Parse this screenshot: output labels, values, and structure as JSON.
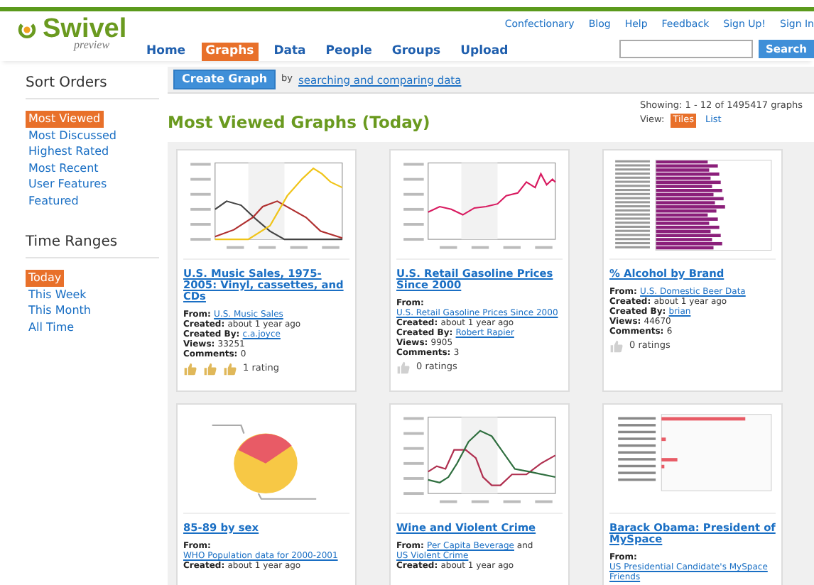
{
  "logo": {
    "name": "Swivel",
    "tagline": "preview"
  },
  "top_links": [
    "Confectionary",
    "Blog",
    "Help",
    "Feedback",
    "Sign Up!",
    "Sign In"
  ],
  "nav_tabs": [
    {
      "label": "Home",
      "selected": false
    },
    {
      "label": "Graphs",
      "selected": true
    },
    {
      "label": "Data",
      "selected": false
    },
    {
      "label": "People",
      "selected": false
    },
    {
      "label": "Groups",
      "selected": false
    },
    {
      "label": "Upload",
      "selected": false
    }
  ],
  "search": {
    "button": "Search"
  },
  "sidebar": [
    {
      "heading": "Sort Orders",
      "items": [
        {
          "label": "Most Viewed",
          "selected": true
        },
        {
          "label": "Most Discussed",
          "selected": false
        },
        {
          "label": "Highest Rated",
          "selected": false
        },
        {
          "label": "Most Recent",
          "selected": false
        },
        {
          "label": "User Features",
          "selected": false
        },
        {
          "label": "Featured",
          "selected": false
        }
      ]
    },
    {
      "heading": "Time Ranges",
      "items": [
        {
          "label": "Today",
          "selected": true
        },
        {
          "label": "This Week",
          "selected": false
        },
        {
          "label": "This Month",
          "selected": false
        },
        {
          "label": "All Time",
          "selected": false
        }
      ]
    }
  ],
  "toolbar": {
    "button": "Create Graph",
    "text": "by",
    "link": "searching and comparing data"
  },
  "page_title": "Most Viewed Graphs (Today)",
  "showing": "Showing: 1 - 12 of 1495417 graphs",
  "view": {
    "label": "View:",
    "options": [
      {
        "label": "Tiles",
        "selected": true
      },
      {
        "label": "List",
        "selected": false
      }
    ]
  },
  "graphs": [
    {
      "kind": "multiline",
      "title": "U.S. Music Sales, 1975-2005: Vinyl, cassettes, and CDs",
      "meta": [
        {
          "label": "From:",
          "links": [
            "U.S. Music Sales"
          ]
        },
        {
          "label": "Created:",
          "text": "about 1 year ago"
        },
        {
          "label": "Created By:",
          "links": [
            "c.a.joyce"
          ]
        },
        {
          "label": "Views:",
          "text": "33251"
        },
        {
          "label": "Comments:",
          "text": "0"
        }
      ],
      "stars": 3,
      "ratings": "1 rating"
    },
    {
      "kind": "line",
      "title": "U.S. Retail Gasoline Prices Since 2000",
      "meta": [
        {
          "label": "From:",
          "links": [
            "U.S. Retail Gasoline Prices Since 2000"
          ]
        },
        {
          "label": "Created:",
          "text": "about 1 year ago"
        },
        {
          "label": "Created By:",
          "links": [
            "Robert Rapier"
          ]
        },
        {
          "label": "Views:",
          "text": "9905"
        },
        {
          "label": "Comments:",
          "text": "3"
        }
      ],
      "ratings": "0 ratings"
    },
    {
      "kind": "hbar",
      "title": "% Alcohol by Brand",
      "meta": [
        {
          "label": "From:",
          "links": [
            "U.S. Domestic Beer Data"
          ]
        },
        {
          "label": "Created:",
          "text": "about 1 year ago"
        },
        {
          "label": "Created By:",
          "links": [
            "brian"
          ]
        },
        {
          "label": "Views:",
          "text": "44670"
        },
        {
          "label": "Comments:",
          "text": "6"
        }
      ],
      "ratings": "0 ratings"
    },
    {
      "kind": "pie",
      "title": "85-89 by sex",
      "meta": [
        {
          "label": "From:",
          "links": [
            "WHO Population data for 2000-2001"
          ]
        },
        {
          "label": "Created:",
          "text": "about 1 year ago"
        }
      ]
    },
    {
      "kind": "twoline",
      "title": "Wine and Violent Crime",
      "meta": [
        {
          "label": "From:",
          "links": [
            "Per Capita Beverage",
            "US Violent Crime"
          ],
          "joiner": "and"
        },
        {
          "label": "Created:",
          "text": "about 1 year ago"
        }
      ]
    },
    {
      "kind": "sparsebar",
      "title": "Barack Obama: President of MySpace",
      "meta": [
        {
          "label": "From:",
          "links": [
            "US Presidential Candidate's MySpace Friends"
          ]
        }
      ]
    }
  ]
}
